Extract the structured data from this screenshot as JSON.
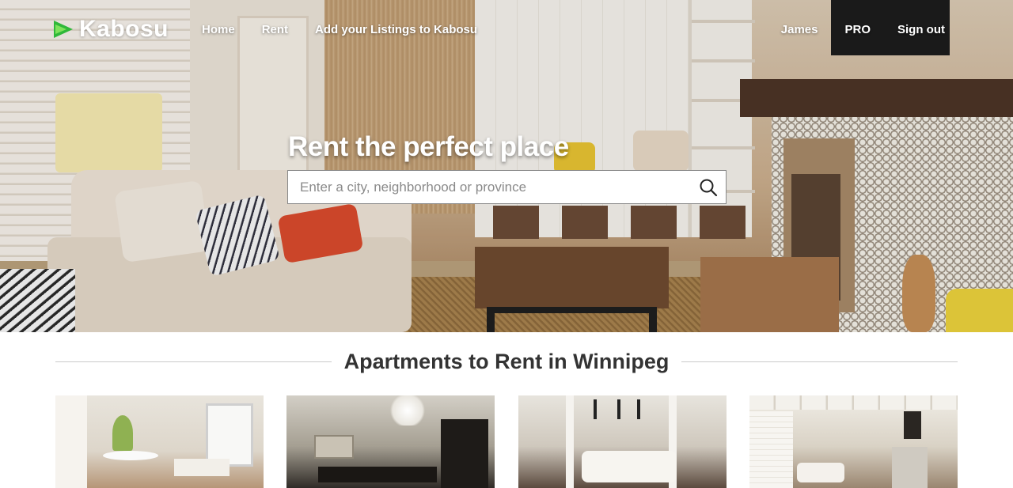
{
  "brand": {
    "name": "Kabosu",
    "accent": "#2fb83a"
  },
  "nav": {
    "left": [
      {
        "label": "Home"
      },
      {
        "label": "Rent"
      },
      {
        "label": "Add your Listings to Kabosu"
      }
    ],
    "right": [
      {
        "label": "James"
      },
      {
        "label": "PRO"
      },
      {
        "label": "Sign out"
      }
    ]
  },
  "hero": {
    "title": "Rent the perfect place",
    "search": {
      "placeholder": "Enter a city, neighborhood or province",
      "value": "",
      "icon": "search-icon"
    }
  },
  "section": {
    "title": "Apartments to Rent in Winnipeg"
  },
  "listings": [
    {
      "image": "dining-living-room-photo"
    },
    {
      "image": "open-plan-dining-photo"
    },
    {
      "image": "bright-living-room-photo"
    },
    {
      "image": "living-room-with-fireplace-photo"
    }
  ]
}
